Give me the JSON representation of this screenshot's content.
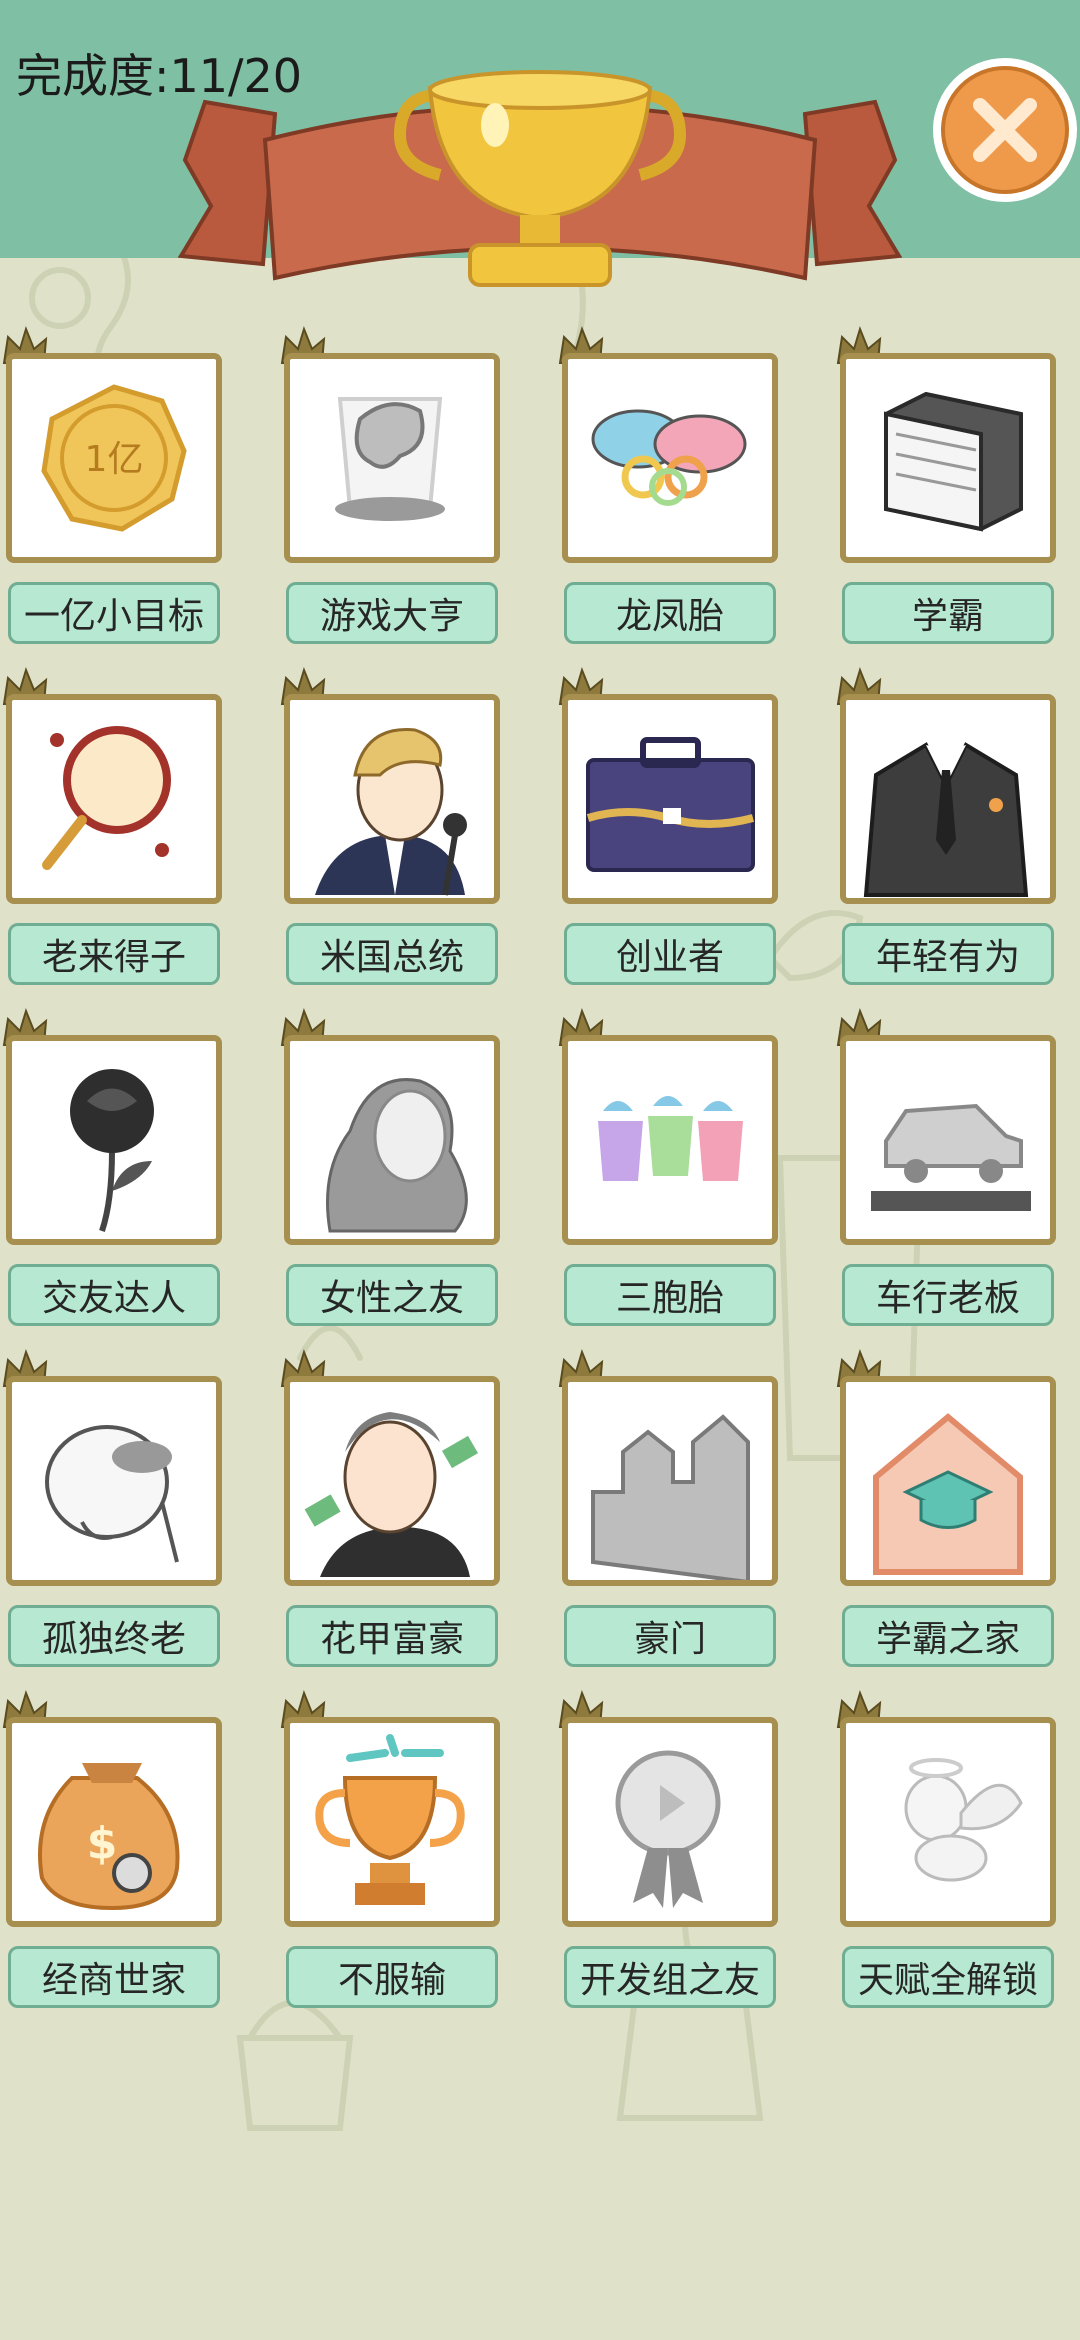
{
  "header": {
    "progress_text": "完成度:11/20",
    "bg_color": "#7fbfa3"
  },
  "accent_colors": {
    "tile_border": "#a68f4f",
    "label_bg": "#b7e8d2",
    "close_btn": "#ef9a4a",
    "ribbon": "#c56a4c",
    "trophy": "#f1c63e"
  },
  "achievements": [
    {
      "label": "一亿小目标",
      "icon": "gold-coin-icon",
      "unlocked": true
    },
    {
      "label": "游戏大亨",
      "icon": "game-controller-trophy-icon",
      "unlocked": false
    },
    {
      "label": "龙凤胎",
      "icon": "twin-pacifiers-icon",
      "unlocked": true
    },
    {
      "label": "学霸",
      "icon": "thick-book-icon",
      "unlocked": true
    },
    {
      "label": "老来得子",
      "icon": "rattle-drum-icon",
      "unlocked": true
    },
    {
      "label": "米国总统",
      "icon": "president-speech-icon",
      "unlocked": true
    },
    {
      "label": "创业者",
      "icon": "briefcase-icon",
      "unlocked": true
    },
    {
      "label": "年轻有为",
      "icon": "suit-icon",
      "unlocked": true
    },
    {
      "label": "交友达人",
      "icon": "black-rose-icon",
      "unlocked": true
    },
    {
      "label": "女性之友",
      "icon": "woman-portrait-icon",
      "unlocked": false
    },
    {
      "label": "三胞胎",
      "icon": "triplet-bottles-icon",
      "unlocked": true
    },
    {
      "label": "车行老板",
      "icon": "car-showroom-icon",
      "unlocked": false
    },
    {
      "label": "孤独终老",
      "icon": "lonely-old-man-icon",
      "unlocked": false
    },
    {
      "label": "花甲富豪",
      "icon": "rich-old-man-icon",
      "unlocked": true
    },
    {
      "label": "豪门",
      "icon": "castle-icon",
      "unlocked": false
    },
    {
      "label": "学霸之家",
      "icon": "graduation-house-icon",
      "unlocked": true
    },
    {
      "label": "经商世家",
      "icon": "money-bag-icon",
      "unlocked": true
    },
    {
      "label": "不服输",
      "icon": "gold-cup-icon",
      "unlocked": true
    },
    {
      "label": "开发组之友",
      "icon": "medal-icon",
      "unlocked": false
    },
    {
      "label": "天赋全解锁",
      "icon": "cupid-angel-icon",
      "unlocked": false
    }
  ]
}
